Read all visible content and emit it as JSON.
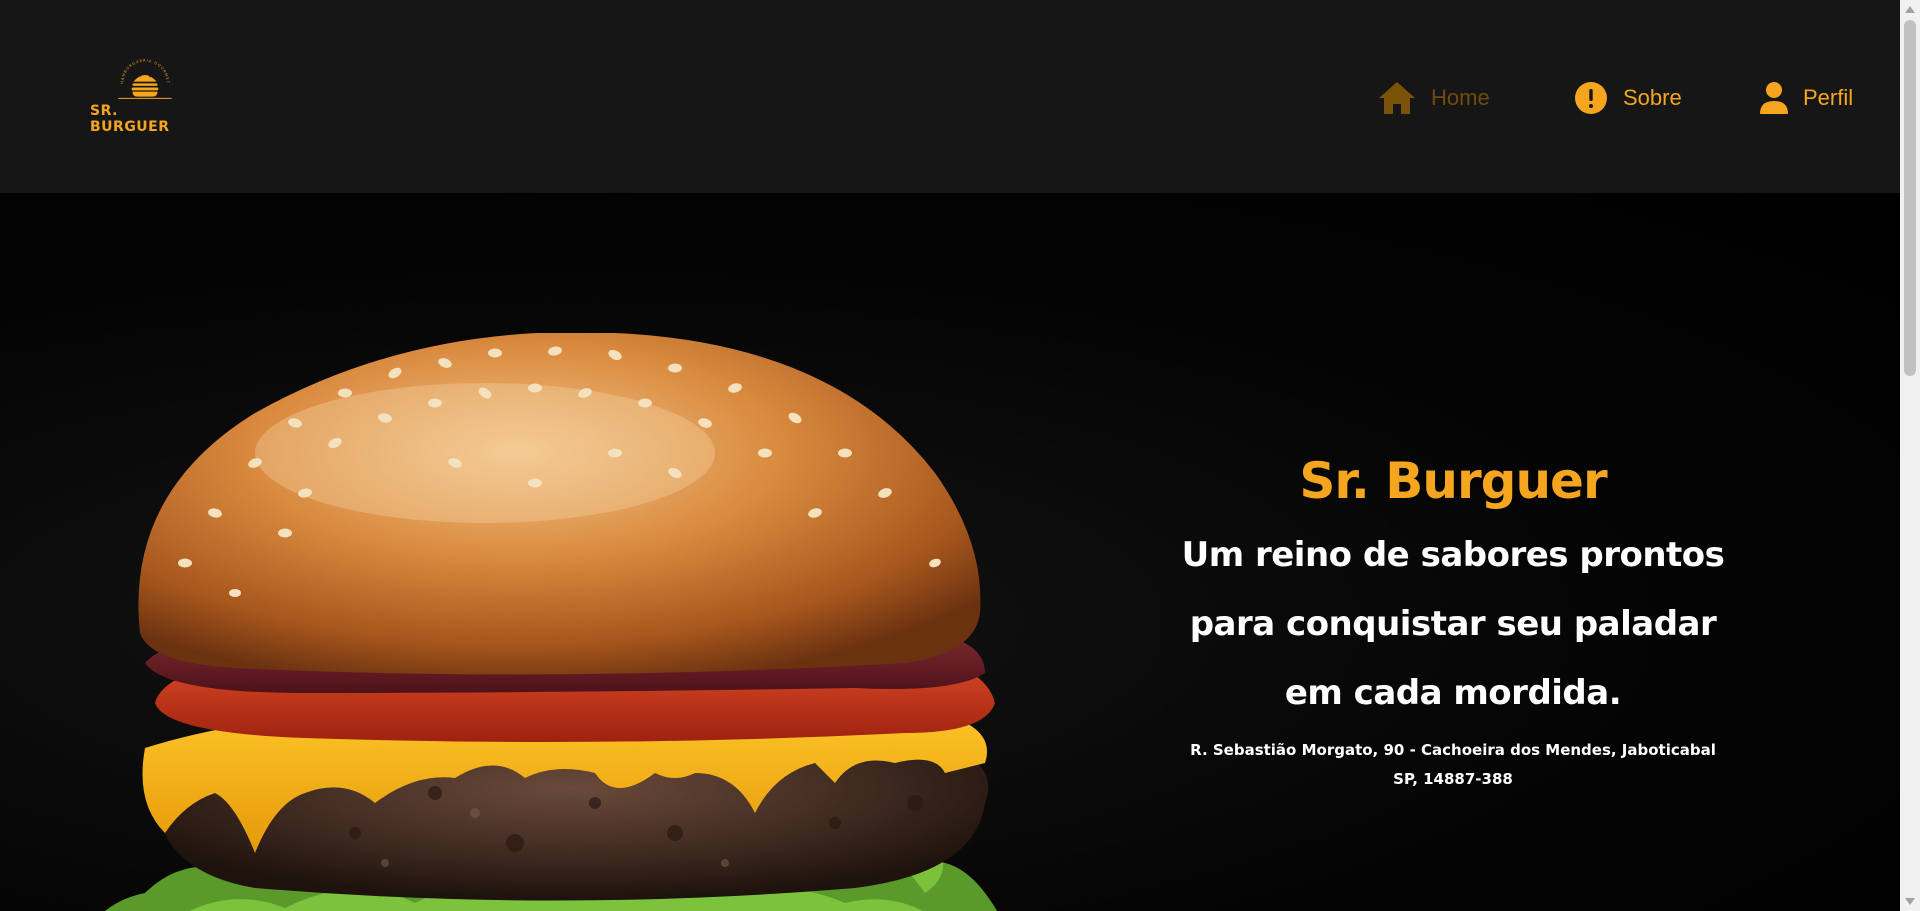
{
  "header": {
    "logo": {
      "arc_text": "HAMBURGUERIA GOURMET",
      "brand": "SR. BURGUER"
    },
    "nav": [
      {
        "label": "Home",
        "icon": "home-icon",
        "active": true
      },
      {
        "label": "Sobre",
        "icon": "exclamation-circle-icon",
        "active": false
      },
      {
        "label": "Perfil",
        "icon": "user-icon",
        "active": false
      }
    ]
  },
  "hero": {
    "title": "Sr. Burguer",
    "tagline_lines": [
      "Um reino de sabores prontos",
      "para conquistar seu paladar",
      "em cada mordida."
    ],
    "address_lines": [
      "R. Sebastião Morgato, 90 - Cachoeira dos Mendes, Jaboticabal",
      "SP, 14887-388"
    ],
    "image": "burger-photo"
  },
  "colors": {
    "accent": "#f5a51e",
    "accent_inactive": "#6e4c0c",
    "header_bg": "#161616",
    "hero_bg": "#000000",
    "text_light": "#ffffff"
  }
}
